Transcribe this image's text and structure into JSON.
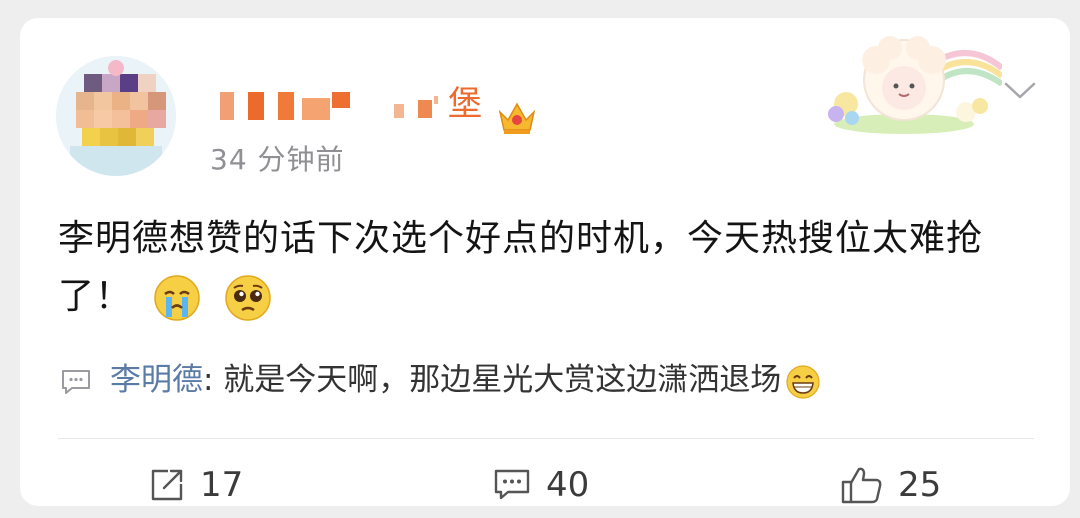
{
  "post": {
    "username": "堡",
    "time": "34 分钟前",
    "content": "李明德想赞的话下次选个好点的时机，今天热搜位太难抢了！",
    "emojis": [
      "crying-face-emoji",
      "pleading-face-emoji"
    ]
  },
  "comment": {
    "author": "李明德",
    "separator": ":",
    "text": " 就是今天啊，那边星光大赏这边潇洒退场",
    "emoji": "grinning-face-emoji"
  },
  "actions": {
    "repost_count": "17",
    "comment_count": "40",
    "like_count": "25"
  },
  "colors": {
    "username": "#ee6a2e",
    "comment_author": "#5b7ba7",
    "muted": "#8f8f94"
  }
}
